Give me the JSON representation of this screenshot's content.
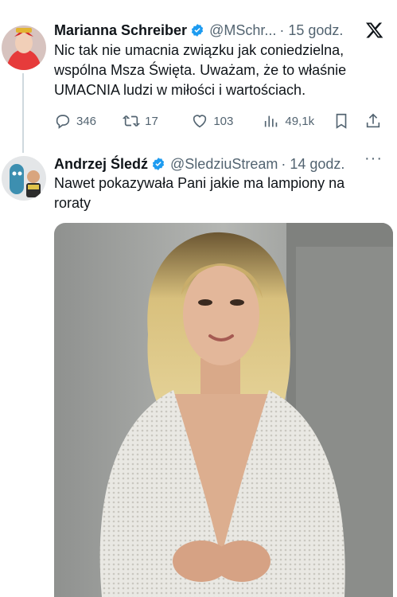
{
  "tweets": [
    {
      "author": "Marianna Schreiber",
      "handle": "@MSchr...",
      "time": "· 15 godz.",
      "text_lines": [
        "Nic tak nie umacnia związku jak coniedzielna,",
        "wspólna Msza Święta. Uważam, że to właśnie",
        "UMACNIA ludzi w miłości i wartościach."
      ],
      "stats": {
        "replies": "346",
        "reposts": "17",
        "likes": "103",
        "views": "49,1k"
      }
    },
    {
      "author": "Andrzej Śledź",
      "handle": "@SledziuStream",
      "time": "· 14 godz.",
      "more": "···",
      "text_lines": [
        "Nawet pokazywała Pani jakie ma lampiony na",
        "roraty"
      ]
    }
  ],
  "colors": {
    "verified": "#1d9bf0",
    "muted": "#536471",
    "text": "#0f1419"
  },
  "icons": [
    "x-logo-icon",
    "reply-icon",
    "repost-icon",
    "like-icon",
    "views-icon",
    "bookmark-icon",
    "share-icon",
    "verified-badge-icon",
    "more-icon"
  ]
}
